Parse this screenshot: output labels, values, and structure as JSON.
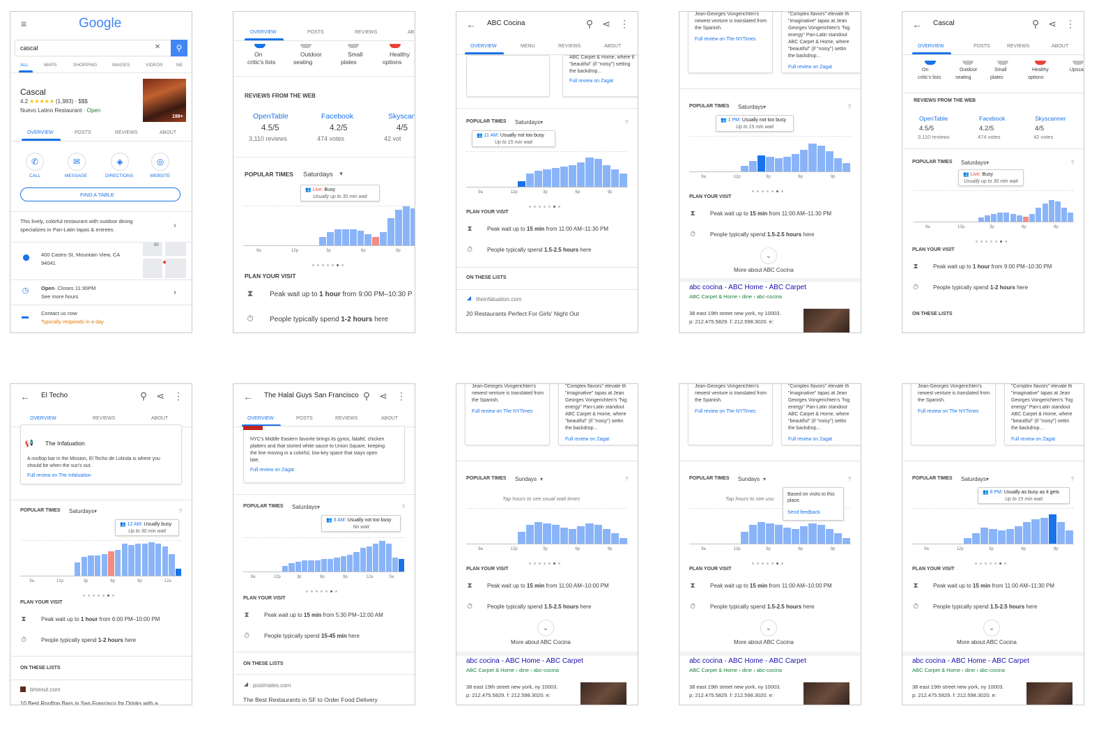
{
  "panels": [
    {
      "id": "p1",
      "type": "search",
      "app_logo": "Google",
      "search_value": "cascal",
      "search_tabs": [
        "ALL",
        "MAPS",
        "SHOPPING",
        "IMAGES",
        "VIDEOS",
        "NE"
      ],
      "title": "Cascal",
      "rating": "4.2",
      "stars": "★★★★★",
      "review_count": "(1,983)",
      "price": "$$$",
      "category": "Nuevo Latino Restaurant",
      "status": "Open",
      "photo_count": "199+",
      "tabs": [
        "OVERVIEW",
        "POSTS",
        "REVIEWS",
        "ABOUT"
      ],
      "actions": [
        "CALL",
        "MESSAGE",
        "DIRECTIONS",
        "WEBSITE"
      ],
      "find_table": "FIND A TABLE",
      "description": [
        "This lively, colorful restaurant with outdoor dining",
        "specializes in Pan-Latin tapas & entrees."
      ],
      "address": [
        "400 Castro St, Mountain View, CA",
        "94041"
      ],
      "hours_status": "Open",
      "hours_close": "· Closes 11:30PM",
      "hours_more": "See more hours",
      "contact_label": "Contact us now",
      "contact_sub": "Typically responds in a day",
      "map_label": "85"
    },
    {
      "id": "p2",
      "type": "details",
      "tabs": [
        "OVERVIEW",
        "POSTS",
        "REVIEWS",
        "AB"
      ],
      "features": [
        [
          "On",
          "critic's lists"
        ],
        [
          "Outdoor",
          "seating"
        ],
        [
          "Small",
          "plates"
        ],
        [
          "Healthy",
          "options"
        ]
      ],
      "reviews_header": "REVIEWS FROM THE WEB",
      "web_reviews": [
        {
          "source": "OpenTable",
          "score": "4.5/5",
          "count": "3,110 reviews"
        },
        {
          "source": "Facebook",
          "score": "4.2/5",
          "count": "474 votes"
        },
        {
          "source": "Skyscan",
          "score": "4/5",
          "count": "42 vot"
        }
      ],
      "popular_label": "POPULAR TIMES",
      "day": "Saturdays",
      "tooltip_line1_prefix": "Live:",
      "tooltip_line1": " Busy",
      "tooltip_line2": "Usually up to 30 min wait",
      "bars": [
        0,
        0,
        0,
        0,
        0,
        0,
        0,
        0,
        0,
        0,
        10,
        16,
        20,
        20,
        20,
        18,
        14,
        10,
        16,
        34,
        44,
        48,
        46
      ],
      "now_index": 17,
      "hour_labels": [
        "9a",
        "12p",
        "3p",
        "6p",
        "9p"
      ],
      "plan_header": "PLAN YOUR VISIT",
      "peak_prefix": "Peak wait up to ",
      "peak_bold": "1 hour",
      "peak_suffix": " from 9:00 PM–10:30 P",
      "spend_prefix": "People typically spend ",
      "spend_bold": "1-2 hours",
      "spend_suffix": " here"
    },
    {
      "id": "p3",
      "type": "abc_top",
      "title": "ABC Cocina",
      "tabs": [
        "OVERVIEW",
        "MENU",
        "REVIEWS",
        "ABOUT"
      ],
      "review_snippet": [
        "ABC Carpet & Home, where tl",
        "\"beautiful\" (if \"noisy\") setting",
        "the backdrop..."
      ],
      "zagat_link": "Full review on Zagat",
      "popular_label": "POPULAR TIMES",
      "day": "Saturdays",
      "tooltip_line1_prefix": "11 AM:",
      "tooltip_line1": " Usually not too busy",
      "tooltip_line2": "Up to 15 min wait",
      "bars": [
        0,
        0,
        0,
        0,
        0,
        0,
        8,
        18,
        22,
        24,
        26,
        28,
        30,
        34,
        40,
        38,
        30,
        24,
        18
      ],
      "sel_index": 6,
      "hour_labels": [
        "9a",
        "12p",
        "3p",
        "6p",
        "9p"
      ],
      "plan_header": "PLAN YOUR VISIT",
      "peak_prefix": "Peak wait up to ",
      "peak_bold": "15 min",
      "peak_suffix": " from 11:00 AM–11:30 PM",
      "spend_prefix": "People typically spend ",
      "spend_bold": "1.5-2.5 hours",
      "spend_suffix": " here",
      "lists_header": "ON THESE LISTS",
      "list_source": "theinfatuation.com",
      "list_title": "20 Restaurants Perfect For Girls' Night Out"
    },
    {
      "id": "p4",
      "type": "abc_scroll",
      "quote_left": [
        "Jean-Georges Vongerichten's",
        "newest venture is translated from",
        "the Spanish."
      ],
      "link_left": "Full review on The NYTimes",
      "quote_right": [
        "\"Complex flavors\" elevate th",
        "\"imaginative\" tapas at Jean",
        "Georges Vongerichten's \"hig",
        "energy\" Pan-Latin standout",
        "ABC Carpet & Home, where",
        "\"beautiful\" (if \"noisy\") settin",
        "the backdrop..."
      ],
      "link_right": "Full review on Zagat",
      "popular_label": "POPULAR TIMES",
      "day": "Saturdays",
      "tooltip_line1_prefix": "1 PM:",
      "tooltip_line1": " Usually not too busy",
      "tooltip_line2": "Up to 15 min wait",
      "bars": [
        0,
        0,
        0,
        0,
        0,
        0,
        8,
        14,
        22,
        20,
        18,
        20,
        24,
        30,
        38,
        36,
        28,
        18,
        12
      ],
      "sel_index": 8,
      "hour_labels": [
        "9a",
        "12p",
        "3p",
        "6p",
        "9p"
      ],
      "plan_header": "PLAN YOUR VISIT",
      "peak_prefix": "Peak wait up to ",
      "peak_bold": "15 min",
      "peak_suffix": " from 11:00 AM–11:30 PM",
      "spend_prefix": "People typically spend ",
      "spend_bold": "1.5-2.5 hours",
      "spend_suffix": " here",
      "more_about": "More about ABC Cocina",
      "result_title": "abc cocina - ABC Home - ABC Carpet",
      "result_url": "ABC Carpet & Home › dine › abc-cocina",
      "result_lines": [
        "38 east 19th street new york, ny 10003.",
        "p: 212.475.5829. f: 212.598.3020. e:"
      ]
    },
    {
      "id": "p5",
      "type": "details_small",
      "title": "Cascal",
      "tabs": [
        "OVERVIEW",
        "POSTS",
        "REVIEWS",
        "ABOUT"
      ],
      "features": [
        [
          "On",
          "critic's lists"
        ],
        [
          "Outdoor",
          "seating"
        ],
        [
          "Small",
          "plates"
        ],
        [
          "Healthy",
          "options"
        ],
        [
          "Upsca",
          ""
        ]
      ],
      "reviews_header": "REVIEWS FROM THE WEB",
      "web_reviews": [
        {
          "source": "OpenTable",
          "score": "4.5/5",
          "count": "3,110 reviews"
        },
        {
          "source": "Facebook",
          "score": "4.2/5",
          "count": "474 votes"
        },
        {
          "source": "Skyscanner",
          "score": "4/5",
          "count": "42 votes"
        }
      ],
      "popular_label": "POPULAR TIMES",
      "day": "Saturdays",
      "tooltip_line1_prefix": "Live:",
      "tooltip_line1": " Busy",
      "tooltip_line2": "Usually up to 30 min wait",
      "bars": [
        0,
        0,
        0,
        0,
        0,
        0,
        0,
        0,
        0,
        0,
        6,
        10,
        12,
        14,
        14,
        12,
        10,
        8,
        12,
        22,
        28,
        34,
        32,
        22,
        14
      ],
      "now_index": 17,
      "hour_labels": [
        "9a",
        "12p",
        "3p",
        "6p",
        "9p"
      ],
      "plan_header": "PLAN YOUR VISIT",
      "peak_prefix": "Peak wait up to ",
      "peak_bold": "1 hour",
      "peak_suffix": " from 9:00 PM–10:30 PM",
      "spend_prefix": "People typically spend ",
      "spend_bold": "1-2 hours",
      "spend_suffix": " here",
      "lists_header": "ON THESE LISTS"
    },
    {
      "id": "p6",
      "type": "eltecho",
      "title": "El Techo",
      "tabs": [
        "OVERVIEW",
        "REVIEWS",
        "ABOUT"
      ],
      "card_source": "The Infatuation",
      "card_text": [
        "A rooftop bar in the Mission, El Techo de Lolinda is where you",
        "should be when the sun's out."
      ],
      "card_link": "Full review on The Infatuation",
      "popular_label": "POPULAR TIMES",
      "day": "Saturdays",
      "tooltip_line1_prefix": "12 AM:",
      "tooltip_line1": " Usually busy",
      "tooltip_line2": "Up to 30 min wait",
      "bars": [
        0,
        0,
        0,
        0,
        0,
        0,
        0,
        0,
        18,
        26,
        28,
        28,
        30,
        34,
        36,
        44,
        42,
        44,
        44,
        46,
        44,
        40,
        30,
        10
      ],
      "now_index": 13,
      "sel_index": 23,
      "hour_labels": [
        "9a",
        "12p",
        "3p",
        "6p",
        "9p",
        "12a"
      ],
      "plan_header": "PLAN YOUR VISIT",
      "peak_prefix": "Peak wait up to ",
      "peak_bold": "1 hour",
      "peak_suffix": " from 6:00 PM–10:00 PM",
      "spend_prefix": "People typically spend ",
      "spend_bold": "1-2 hours",
      "spend_suffix": " here",
      "lists_header": "ON THESE LISTS",
      "list_source": "timeout.com",
      "list_title": "10 Best Rooftop Bars in San Francisco for Drinks with a"
    },
    {
      "id": "p7",
      "type": "halal",
      "title": "The Halal Guys San Francisco",
      "tabs": [
        "OVERVIEW",
        "POSTS",
        "REVIEWS",
        "ABOUT"
      ],
      "card_text": [
        "NYC's Middle Eastern favorite brings its gyros, falafel, chicken",
        "platters and that storied white sauce to Union Square, keeping",
        "the line moving in a colorful, low-key space that stays open",
        "late."
      ],
      "card_link": "Full review on Zagat",
      "popular_label": "POPULAR TIMES",
      "day": "Saturdays",
      "tooltip_line1_prefix": "3 AM:",
      "tooltip_line1": " Usually not too busy",
      "tooltip_line2": "No wait",
      "bars": [
        0,
        0,
        0,
        0,
        0,
        0,
        8,
        12,
        14,
        16,
        16,
        16,
        18,
        18,
        20,
        22,
        24,
        28,
        34,
        36,
        40,
        44,
        40,
        20,
        18
      ],
      "sel_index": 24,
      "hour_labels": [
        "9a",
        "12p",
        "3p",
        "6p",
        "9p",
        "12a",
        "3a"
      ],
      "plan_header": "PLAN YOUR VISIT",
      "peak_prefix": "Peak wait up to ",
      "peak_bold": "15 min",
      "peak_suffix": " from 5:30 PM–12:00 AM",
      "spend_prefix": "People typically spend ",
      "spend_bold": "15-45 min",
      "spend_suffix": " here",
      "lists_header": "ON THESE LISTS",
      "list_source": "postmates.com",
      "list_title": "The Best Restaurants in SF to Order Food Delivery"
    },
    {
      "id": "p8",
      "type": "abc_sunday",
      "quote_left": [
        "Jean-Georges Vongerichten's",
        "newest venture is translated from",
        "the Spanish."
      ],
      "link_left": "Full review on The NYTimes",
      "quote_right": [
        "\"Complex flavors\" elevate th",
        "\"imaginative\" tapas at Jean",
        "Georges Vongerichten's \"hig",
        "energy\" Pan-Latin standout",
        "ABC Carpet & Home, where",
        "\"beautiful\" (if \"noisy\") settin",
        "the backdrop..."
      ],
      "link_right": "Full review on Zagat",
      "popular_label": "POPULAR TIMES",
      "day": "Sundays",
      "hint": "Tap hours to see usual wait times",
      "bars": [
        0,
        0,
        0,
        0,
        0,
        0,
        16,
        26,
        30,
        28,
        26,
        22,
        20,
        24,
        28,
        26,
        20,
        14,
        8
      ],
      "hour_labels": [
        "9a",
        "12p",
        "3p",
        "6p",
        "9p"
      ],
      "plan_header": "PLAN YOUR VISIT",
      "peak_prefix": "Peak wait up to ",
      "peak_bold": "15 min",
      "peak_suffix": " from 11:00 AM–10:00 PM",
      "spend_prefix": "People typically spend ",
      "spend_bold": "1.5-2.5 hours",
      "spend_suffix": " here",
      "more_about": "More about ABC Cocina",
      "result_title": "abc cocina - ABC Home - ABC Carpet",
      "result_url": "ABC Carpet & Home › dine › abc-cocina",
      "result_lines": [
        "38 east 19th street new york, ny 10003.",
        "p: 212.475.5829. f: 212.598.3020. e:"
      ]
    },
    {
      "id": "p9",
      "type": "abc_sunday_help",
      "quote_left": [
        "Jean-Georges Vongerichten's",
        "newest venture is translated from",
        "the Spanish."
      ],
      "link_left": "Full review on The NYTimes",
      "quote_right": [
        "\"Complex flavors\" elevate th",
        "\"imaginative\" tapas at Jean",
        "Georges Vongerichten's \"hig",
        "energy\" Pan-Latin standout",
        "ABC Carpet & Home, where",
        "\"beautiful\" (if \"noisy\") settin",
        "the backdrop..."
      ],
      "link_right": "Full review on Zagat",
      "popular_label": "POPULAR TIMES",
      "day": "Sundays",
      "hint": "Tap hours to see usu",
      "help_lines": [
        "Based on visits to this",
        "place."
      ],
      "help_link": "Send feedback",
      "bars": [
        0,
        0,
        0,
        0,
        0,
        0,
        16,
        26,
        30,
        28,
        26,
        22,
        20,
        24,
        28,
        26,
        20,
        14,
        8
      ],
      "hour_labels": [
        "9a",
        "12p",
        "3p",
        "6p",
        "9p"
      ],
      "plan_header": "PLAN YOUR VISIT",
      "peak_prefix": "Peak wait up to ",
      "peak_bold": "15 min",
      "peak_suffix": " from 11:00 AM–10:00 PM",
      "spend_prefix": "People typically spend ",
      "spend_bold": "1.5-2.5 hours",
      "spend_suffix": " here",
      "more_about": "More about ABC Cocina",
      "result_title": "abc cocina - ABC Home - ABC Carpet",
      "result_url": "ABC Carpet & Home › dine › abc-cocina",
      "result_lines": [
        "38 east 19th street new york, ny 10003.",
        "p: 212.475.5829. f: 212.598.3020. e:"
      ]
    },
    {
      "id": "p10",
      "type": "abc_8pm",
      "quote_left": [
        "Jean-Georges Vongerichten's",
        "newest venture is translated from",
        "the Spanish."
      ],
      "link_left": "Full review on The NYTimes",
      "quote_right": [
        "\"Complex flavors\" elevate th",
        "\"imaginative\" tapas at Jean",
        "Georges Vongerichten's \"hig",
        "energy\" Pan-Latin standout",
        "ABC Carpet & Home, where",
        "\"beautiful\" (if \"noisy\") settin",
        "the backdrop..."
      ],
      "link_right": "Full review on Zagat",
      "popular_label": "POPULAR TIMES",
      "day": "Saturdays",
      "tooltip_line1_prefix": "8 PM:",
      "tooltip_line1": " Usually as busy as it gets",
      "tooltip_line2": "Up to 15 min wait",
      "bars": [
        0,
        0,
        0,
        0,
        0,
        0,
        8,
        14,
        22,
        20,
        18,
        20,
        24,
        30,
        34,
        36,
        40,
        30,
        18
      ],
      "sel_index": 16,
      "hour_labels": [
        "9a",
        "12p",
        "3p",
        "6p",
        "9p"
      ],
      "plan_header": "PLAN YOUR VISIT",
      "peak_prefix": "Peak wait up to ",
      "peak_bold": "15 min",
      "peak_suffix": " from 11:00 AM–11:30 PM",
      "spend_prefix": "People typically spend ",
      "spend_bold": "1.5-2.5 hours",
      "spend_suffix": " here",
      "more_about": "More about ABC Cocina",
      "result_title": "abc cocina - ABC Home - ABC Carpet",
      "result_url": "ABC Carpet & Home › dine › abc-cocina",
      "result_lines": [
        "38 east 19th street new york, ny 10003.",
        "p: 212.475.5829. f: 212.598.3020. e:"
      ]
    }
  ],
  "colors": {
    "accent": "#1a73e8",
    "bar": "#8ab4f8",
    "live": "#f28b82",
    "link_green": "#188038",
    "orange": "#e37400"
  }
}
